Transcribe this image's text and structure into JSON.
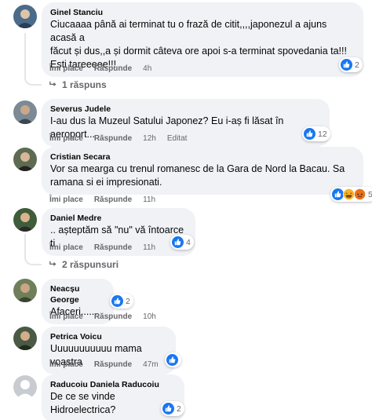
{
  "comments": [
    {
      "author": "Ginel Stanciu",
      "lines": [
        "Ciucaaaa până ai terminat tu o frază de citit,,,,japonezul a ajuns acasă a",
        "făcut și dus,,a și dormit câteva ore apoi s-a terminat spovedania ta!!!",
        "Ești tareeeee!!!"
      ],
      "like": "Îmi place",
      "reply": "Răspunde",
      "time": "4h",
      "reactions": "2",
      "replies_label": "1 răspuns"
    },
    {
      "author": "Severus Judele",
      "lines": [
        "I-au dus la Muzeul Satului Japonez? Eu i-aș fi lăsat în aeroport..."
      ],
      "like": "Îmi place",
      "reply": "Răspunde",
      "time": "12h",
      "edited": "Editat",
      "reactions": "12"
    },
    {
      "author": "Cristian Secara",
      "lines": [
        "Vor sa mearga cu trenul romanesc de la Gara de Nord la Bacau. Sa",
        "ramana si ei impresionati."
      ],
      "like": "Îmi place",
      "reply": "Răspunde",
      "time": "11h",
      "reactions": "5"
    },
    {
      "author": "Daniel Medre",
      "lines": [
        ".. așteptăm să \"nu\" vă întoarce ti"
      ],
      "like": "Îmi place",
      "reply": "Răspunde",
      "time": "11h",
      "reactions": "4",
      "replies_label": "2 răspunsuri"
    },
    {
      "author": "Neacșu George",
      "lines": [
        "Afaceri......"
      ],
      "like": "Îmi place",
      "reply": "Răspunde",
      "time": "10h",
      "reactions": "2"
    },
    {
      "author": "Petrica Voicu",
      "lines": [
        "Uuuuuuuuuuu mama voastra"
      ],
      "like": "Îmi place",
      "reply": "Răspunde",
      "time": "47m",
      "reactions": ""
    },
    {
      "author": "Raducoiu Daniela Raducoiu",
      "lines": [
        "De ce se vinde Hidroelectrica?"
      ],
      "like": "Îmi place",
      "reply": "Răspunde",
      "time": "",
      "reactions": "2"
    }
  ],
  "colors": {
    "bubble": "#f0f2f5",
    "like_blue": "#1877f2",
    "meta_gray": "#65676b"
  }
}
